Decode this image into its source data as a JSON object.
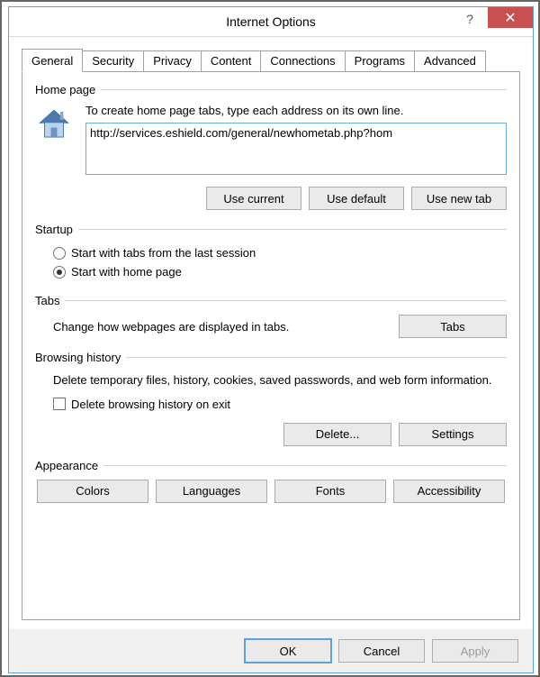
{
  "window": {
    "title": "Internet Options"
  },
  "tabs": {
    "items": [
      "General",
      "Security",
      "Privacy",
      "Content",
      "Connections",
      "Programs",
      "Advanced"
    ],
    "active_index": 0
  },
  "homepage": {
    "group_title": "Home page",
    "description": "To create home page tabs, type each address on its own line.",
    "url_value": "http://services.eshield.com/general/newhometab.php?hom",
    "buttons": {
      "use_current": "Use current",
      "use_default": "Use default",
      "use_new_tab": "Use new tab"
    }
  },
  "startup": {
    "group_title": "Startup",
    "option_last_session": "Start with tabs from the last session",
    "option_home_page": "Start with home page",
    "selected": "home_page"
  },
  "tabs_section": {
    "group_title": "Tabs",
    "description": "Change how webpages are displayed in tabs.",
    "button": "Tabs"
  },
  "history": {
    "group_title": "Browsing history",
    "description": "Delete temporary files, history, cookies, saved passwords, and web form information.",
    "checkbox_label": "Delete browsing history on exit",
    "checkbox_checked": false,
    "buttons": {
      "delete": "Delete...",
      "settings": "Settings"
    }
  },
  "appearance": {
    "group_title": "Appearance",
    "buttons": {
      "colors": "Colors",
      "languages": "Languages",
      "fonts": "Fonts",
      "accessibility": "Accessibility"
    }
  },
  "footer": {
    "ok": "OK",
    "cancel": "Cancel",
    "apply": "Apply"
  }
}
